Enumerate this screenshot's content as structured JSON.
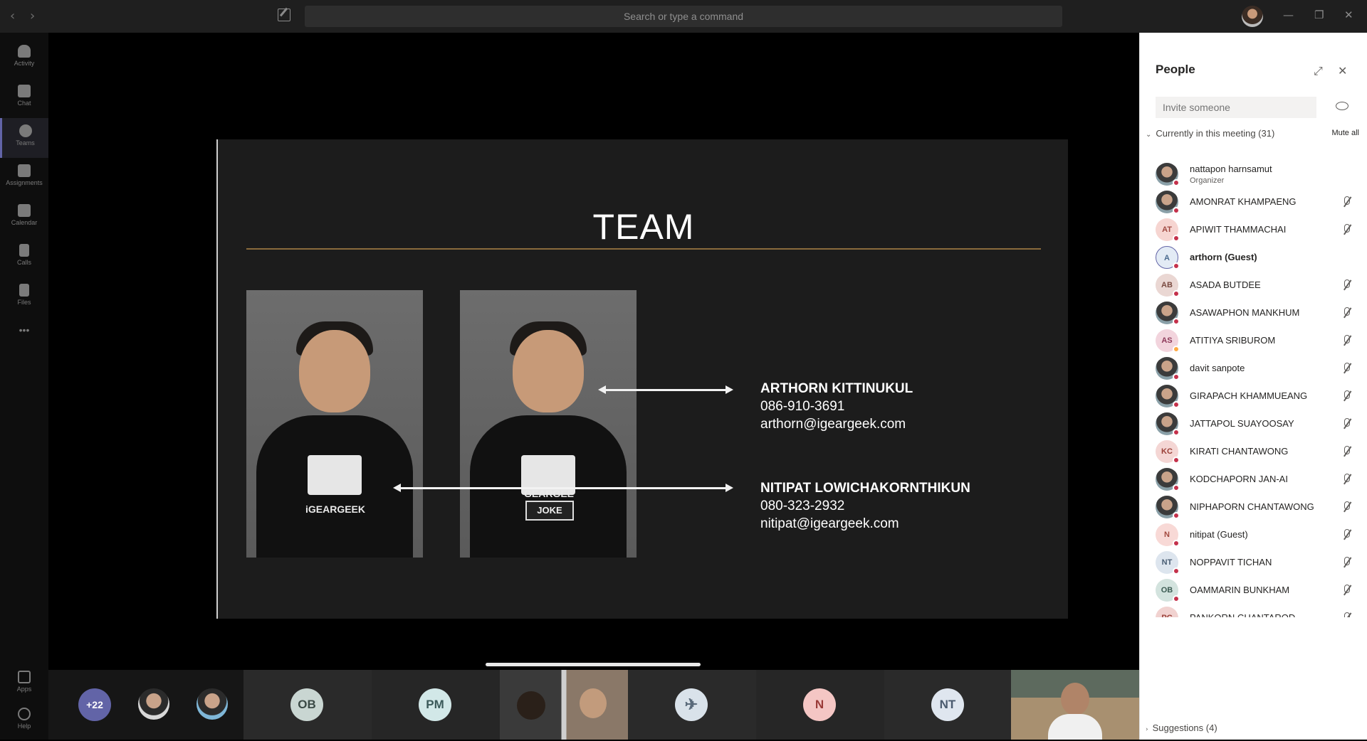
{
  "titlebar": {
    "search_placeholder": "Search or type a command",
    "back_glyph": "‹",
    "forward_glyph": "›",
    "minimize_glyph": "—",
    "maximize_glyph": "❐",
    "close_glyph": "✕"
  },
  "rail": {
    "items": [
      {
        "label": "Activity",
        "icon": "bell-icon"
      },
      {
        "label": "Chat",
        "icon": "chat-icon"
      },
      {
        "label": "Teams",
        "icon": "teams-icon"
      },
      {
        "label": "Assignments",
        "icon": "assignments-icon"
      },
      {
        "label": "Calendar",
        "icon": "calendar-icon"
      },
      {
        "label": "Calls",
        "icon": "phone-icon"
      },
      {
        "label": "Files",
        "icon": "files-icon"
      },
      {
        "label": "•••",
        "icon": "more-icon"
      },
      {
        "label": "Apps",
        "icon": "apps-icon"
      },
      {
        "label": "Help",
        "icon": "help-icon"
      }
    ],
    "active": "Teams"
  },
  "slide": {
    "title": "TEAM",
    "left_logo_text": "iGEARGEEK",
    "right_logo_text": "GEARGEE",
    "sign_text": "JOKE",
    "contacts": [
      {
        "name": "ARTHORN KITTINUKUL",
        "phone": "086-910-3691",
        "email": "arthorn@igeargeek.com"
      },
      {
        "name": "NITIPAT LOWICHAKORNTHIKUN",
        "phone": "080-323-2932",
        "email": "nitipat@igeargeek.com"
      }
    ]
  },
  "strip": {
    "overflow_count": "+22",
    "initials": [
      "OB",
      "PM",
      "N",
      "NT"
    ]
  },
  "people": {
    "title": "People",
    "invite_placeholder": "Invite someone",
    "section_label": "Currently in this meeting (31)",
    "mute_all": "Mute all",
    "suggestions": "Suggestions (4)",
    "members": [
      {
        "name": "nattapon harnsamut",
        "role": "Organizer",
        "avatar": "photo"
      },
      {
        "name": "AMONRAT KHAMPAENG",
        "avatar": "photo"
      },
      {
        "name": "APIWIT THAMMACHAI",
        "initials": "AT"
      },
      {
        "name": "arthorn (Guest)",
        "initials": "A"
      },
      {
        "name": "ASADA BUTDEE",
        "initials": "AB"
      },
      {
        "name": "ASAWAPHON MANKHUM",
        "avatar": "photo"
      },
      {
        "name": "ATITIYA SRIBUROM",
        "initials": "AS"
      },
      {
        "name": "davit sanpote",
        "avatar": "photo"
      },
      {
        "name": "GIRAPACH KHAMMUEANG",
        "avatar": "photo"
      },
      {
        "name": "JATTAPOL SUAYOOSAY",
        "avatar": "photo"
      },
      {
        "name": "KIRATI CHANTAWONG",
        "initials": "KC"
      },
      {
        "name": "KODCHAPORN JAN-AI",
        "avatar": "photo"
      },
      {
        "name": "NIPHAPORN CHANTAWONG",
        "avatar": "photo"
      },
      {
        "name": "nitipat (Guest)",
        "initials": "N"
      },
      {
        "name": "NOPPAVIT TICHAN",
        "initials": "NT"
      },
      {
        "name": "OAMMARIN BUNKHAM",
        "initials": "OB"
      },
      {
        "name": "PANKORN CHANTAROD",
        "initials": "PC"
      }
    ]
  }
}
